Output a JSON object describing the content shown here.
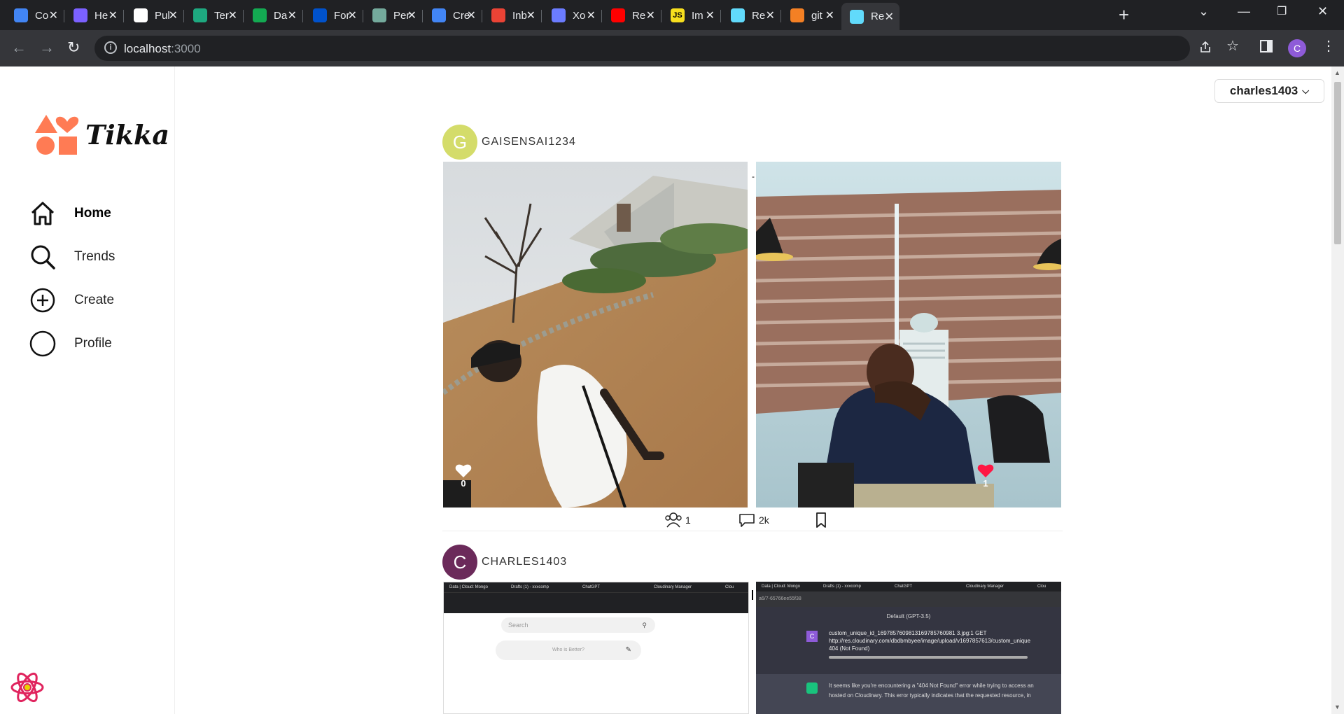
{
  "browser": {
    "tabs": [
      {
        "title": "Co",
        "icon": "docs-icon",
        "color": "#4285f4"
      },
      {
        "title": "He",
        "icon": "shield-icon",
        "color": "#7b61ff"
      },
      {
        "title": "Pul",
        "icon": "github-icon",
        "color": "#ffffff"
      },
      {
        "title": "Ter",
        "icon": "terminal-icon",
        "color": "#1ea980"
      },
      {
        "title": "Da",
        "icon": "leaf-icon",
        "color": "#13aa52"
      },
      {
        "title": "For",
        "icon": "forms-icon",
        "color": "#0052cc"
      },
      {
        "title": "Per",
        "icon": "chatgpt-icon",
        "color": "#74aa9c"
      },
      {
        "title": "Cre",
        "icon": "google-icon",
        "color": "#4285f4"
      },
      {
        "title": "Inb",
        "icon": "gmail-icon",
        "color": "#ea4335"
      },
      {
        "title": "Xo",
        "icon": "orb-icon",
        "color": "#6b7cff"
      },
      {
        "title": "Re",
        "icon": "youtube-icon",
        "color": "#ff0000"
      },
      {
        "title": "Im",
        "icon": "js-icon",
        "color": "#f7df1e"
      },
      {
        "title": "Re",
        "icon": "react-icon",
        "color": "#61dafb"
      },
      {
        "title": "git",
        "icon": "stackoverflow-icon",
        "color": "#f48024"
      },
      {
        "title": "Re",
        "icon": "react-icon",
        "color": "#61dafb"
      }
    ],
    "url_host": "localhost",
    "url_port": ":3000",
    "profile_initial": "C"
  },
  "app": {
    "logo_text": "Tikka",
    "nav": [
      {
        "label": "Home",
        "icon": "home-icon",
        "active": true
      },
      {
        "label": "Trends",
        "icon": "search-icon",
        "active": false
      },
      {
        "label": "Create",
        "icon": "plus-circle-icon",
        "active": false
      },
      {
        "label": "Profile",
        "icon": "profile-circle-icon",
        "active": false
      }
    ],
    "user_menu": "charles1403"
  },
  "posts": [
    {
      "user": "GAISENSAI1234",
      "avatar_initial": "G",
      "avatar_color": "#d4dc6a",
      "photos": [
        {
          "likes": "0",
          "liked": false
        },
        {
          "likes": "1",
          "liked": true
        }
      ],
      "followers": "1",
      "comments": "2k"
    },
    {
      "user": "CHARLES1403",
      "avatar_initial": "C",
      "avatar_color": "#6b2a5a",
      "screenshot_left": {
        "tabs": [
          "Data | Cloud: Mongo",
          "Drafts (1) - xxxcomp",
          "ChatGPT",
          "Cloudinary Manager",
          "Clou"
        ],
        "search_placeholder": "Search",
        "whats_better": "Who is Better?"
      },
      "screenshot_right": {
        "tabs": [
          "Data | Cloud: Mongo",
          "Drafts (1) - xxxcomp",
          "ChatGPT",
          "Cloudinary Manager",
          "Clou"
        ],
        "url_fragment": "a6/7-65766ee55f38",
        "model": "Default (GPT-3.5)",
        "user_msg_line1": "custom_unique_id_1697857609813169785760981 3.jpg:1     GET",
        "user_msg_line2": "http://res.cloudinary.com/dbdbmbyee/image/upload/v1697857613/custom_unique",
        "user_msg_line3": "404 (Not Found)",
        "bot_msg_line1": "It seems like you're encountering a \"404 Not Found\" error while trying to access an",
        "bot_msg_line2": "hosted on Cloudinary. This error typically indicates that the requested resource, in"
      }
    }
  ]
}
